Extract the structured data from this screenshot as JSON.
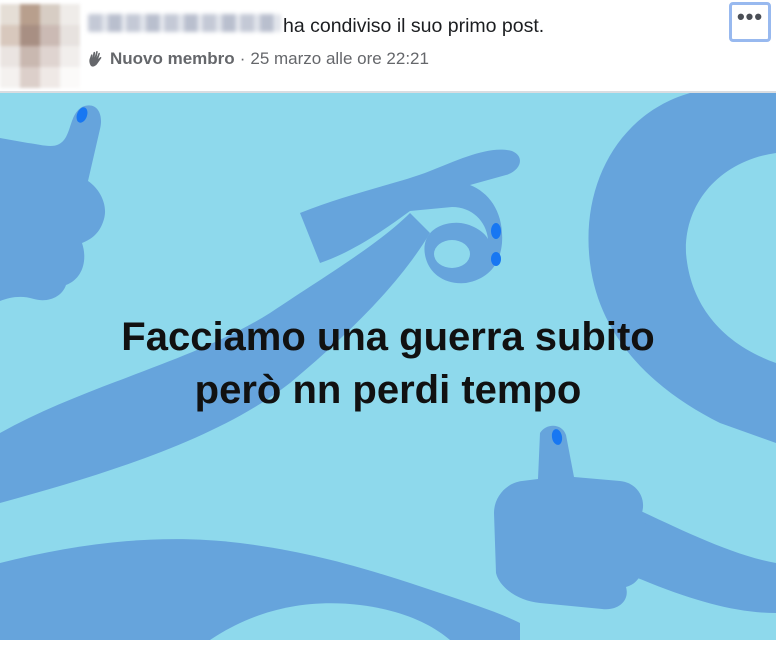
{
  "post": {
    "author": "",
    "action_text": "ha condiviso il suo primo post.",
    "badge_label": "Nuovo membro",
    "badge_icon": "waving-hand-icon",
    "separator": "·",
    "timestamp": "25 marzo alle ore 22:21",
    "more_icon": "more-options-icon",
    "more_label": "•••",
    "body_line_1": "Facciamo una guerra subito",
    "body_line_2": "però nn perdi tempo"
  },
  "colors": {
    "banner_background": "#8ed9ec",
    "shape_blue": "#66a4dc",
    "nail_blue": "#1877f2",
    "text_dark": "#111111",
    "meta_gray": "#65676b"
  }
}
